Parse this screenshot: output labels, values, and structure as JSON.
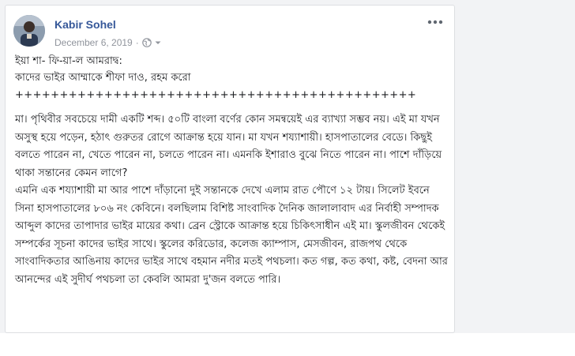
{
  "post": {
    "author_name": "Kabir Sohel",
    "date": "December 6, 2019",
    "meta_separator": "·",
    "audience_icon": "globe-icon",
    "options_icon": "more-horizontal-icon",
    "lines": {
      "greeting_1": "ইয়া শা- ফি-য়া-ল আমরাদ্ব:",
      "greeting_2": "কাদের ভাইর আম্মাকে শীফা দাও, রহম করো",
      "divider": "+++++++++++++++++++++++++++++++++++++++++++++"
    },
    "paragraphs": [
      "মা। পৃথিবীর সবচেয়ে দামী একটি শব্দ। ৫০টি বাংলা বর্ণের কোন সমন্বয়েই এর ব্যাখ্যা সম্ভব নয়। এই মা যখন অসুস্থ হয়ে পড়েন, হঠাৎ গুরুতর রোগে আক্রান্ত হয়ে যান। মা যখন শয্যাশায়ী। হাসপাতালের বেডে। কিছুই বলতে পারেন না, খেতে পারেন না, চলতে পারেন না। এমনকি ইশারাও বুঝে নিতে পারেন না। পাশে দাঁড়িয়ে থাকা সন্তানের কেমন লাগে?",
      "এমনি এক শয্যাশায়ী মা আর পাশে দাঁড়ানো দুই সন্তানকে দেখে এলাম রাত পৌণে ১২ টায়। সিলেট ইবনে সিনা হাসপাতালের ৮০৬ নং কেবিনে। বলছিলাম বিশিষ্ট সাংবাদিক দৈনিক জালালাবাদ এর নির্বাহী সম্পাদক আব্দুল কাদের তাপাদার ভাইর মায়ের কথা। ব্রেন স্ট্রোকে আক্রান্ত হয়ে চিকিৎসাধীন এই মা। স্কুলজীবন থেকেই সম্পর্কের সূচনা কাদের ভাইর সাথে। স্কুলের করিডোর, কলেজ ক্যাম্পাস, মেসজীবন, রাজপথ থেকে সাংবাদিকতার আঙিনায় কাদের ভাইর সাথে বহমান নদীর মতই পথচলা। কত গল্প, কত কথা, কষ্ট, বেদনা আর আনন্দের এই সুদীর্ঘ পথচলা তা কেবলি আমরা দু'জন বলতে পারি।"
    ]
  },
  "colors": {
    "author_link": "#365899",
    "meta_text": "#90949c",
    "body_text": "#1c1e21",
    "card_border": "#dddfe2",
    "backdrop": "#f2f3f5"
  }
}
